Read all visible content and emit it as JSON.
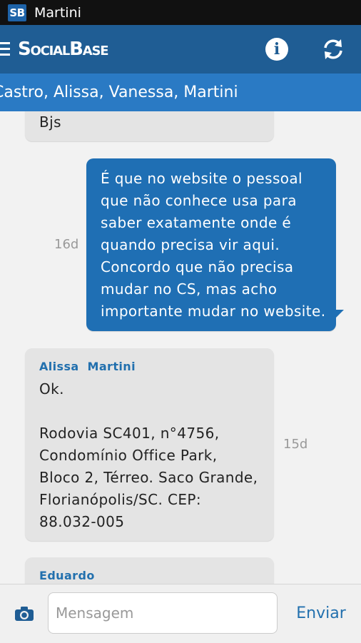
{
  "statusbar": {
    "app_badge": "SB",
    "title": "Martini"
  },
  "actionbar": {
    "brand": "SocialBase",
    "info_icon": "info-icon",
    "refresh_icon": "refresh-icon",
    "menu_icon": "hamburger-icon"
  },
  "conversation": {
    "participants": "Castro, Alissa, Vanessa, Martini"
  },
  "messages": [
    {
      "direction": "in",
      "text": "Bjs"
    },
    {
      "direction": "out",
      "lines": [
        "É que no website o pessoal",
        "que não conhece usa para",
        "saber exatamente onde é",
        "quando precisa vir aqui.",
        "Concordo que não precisa",
        "mudar no CS, mas acho",
        "importante mudar no website."
      ],
      "time": "16d"
    },
    {
      "direction": "in",
      "sender": "Alissa  Martini",
      "lines": [
        "Ok.",
        "",
        "Rodovia SC401, n°4756,",
        "Condomínio Office Park,",
        "Bloco 2, Térreo. Saco Grande,",
        "Florianópolis/SC. CEP:",
        "88.032-005"
      ],
      "time": "15d"
    },
    {
      "direction": "in",
      "sender": "Eduardo"
    }
  ],
  "composer": {
    "placeholder": "Mensagem",
    "send_label": "Enviar",
    "camera_icon": "camera-icon"
  },
  "colors": {
    "actionbar": "#1f5d94",
    "participants_bar": "#2a7ac4",
    "outgoing_bubble": "#1f6fb4",
    "incoming_bubble": "#e4e4e4",
    "accent_text": "#2270ae"
  }
}
